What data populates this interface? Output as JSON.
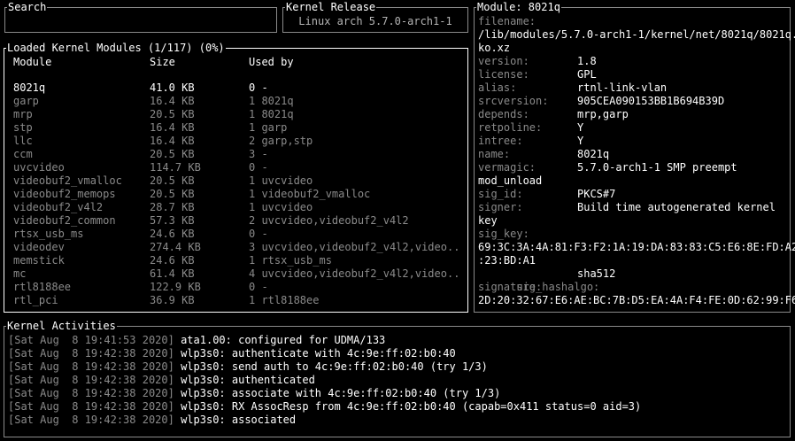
{
  "search": {
    "title": "Search",
    "value": ""
  },
  "kernel_release": {
    "title": "Kernel Release",
    "value": "Linux arch 5.7.0-arch1-1"
  },
  "modules": {
    "title": "Loaded Kernel Modules (1/117) (0%)",
    "columns": {
      "name": "Module",
      "size": "Size",
      "used_by": "Used by"
    },
    "rows": [
      {
        "name": "8021q",
        "size": "41.0 KB",
        "used_by": "0 -"
      },
      {
        "name": "garp",
        "size": "16.4 KB",
        "used_by": "1 8021q"
      },
      {
        "name": "mrp",
        "size": "20.5 KB",
        "used_by": "1 8021q"
      },
      {
        "name": "stp",
        "size": "16.4 KB",
        "used_by": "1 garp"
      },
      {
        "name": "llc",
        "size": "16.4 KB",
        "used_by": "2 garp,stp"
      },
      {
        "name": "ccm",
        "size": "20.5 KB",
        "used_by": "3 -"
      },
      {
        "name": "uvcvideo",
        "size": "114.7 KB",
        "used_by": "0 -"
      },
      {
        "name": "videobuf2_vmalloc",
        "size": "20.5 KB",
        "used_by": "1 uvcvideo"
      },
      {
        "name": "videobuf2_memops",
        "size": "20.5 KB",
        "used_by": "1 videobuf2_vmalloc"
      },
      {
        "name": "videobuf2_v4l2",
        "size": "28.7 KB",
        "used_by": "1 uvcvideo"
      },
      {
        "name": "videobuf2_common",
        "size": "57.3 KB",
        "used_by": "2 uvcvideo,videobuf2_v4l2"
      },
      {
        "name": "rtsx_usb_ms",
        "size": "24.6 KB",
        "used_by": "0 -"
      },
      {
        "name": "videodev",
        "size": "274.4 KB",
        "used_by": "3 uvcvideo,videobuf2_v4l2,video..."
      },
      {
        "name": "memstick",
        "size": "24.6 KB",
        "used_by": "1 rtsx_usb_ms"
      },
      {
        "name": "mc",
        "size": "61.4 KB",
        "used_by": "4 uvcvideo,videobuf2_v4l2,video..."
      },
      {
        "name": "rtl8188ee",
        "size": "122.9 KB",
        "used_by": "0 -"
      },
      {
        "name": "rtl_pci",
        "size": "36.9 KB",
        "used_by": "1 rtl8188ee"
      }
    ]
  },
  "module_info": {
    "title": "Module: 8021q",
    "filename_key": "filename:",
    "filename_lines": [
      "/lib/modules/5.7.0-arch1-1/kernel/net/8021q/8021q.",
      "ko.xz"
    ],
    "fields": [
      {
        "key": "version:",
        "value": "1.8"
      },
      {
        "key": "license:",
        "value": "GPL"
      },
      {
        "key": "alias:",
        "value": "rtnl-link-vlan"
      },
      {
        "key": "srcversion:",
        "value": "905CEA090153BB1B694B39D"
      },
      {
        "key": "depends:",
        "value": "mrp,garp"
      },
      {
        "key": "retpoline:",
        "value": "Y"
      },
      {
        "key": "intree:",
        "value": "Y"
      },
      {
        "key": "name:",
        "value": "8021q"
      },
      {
        "key": "vermagic:",
        "value": "5.7.0-arch1-1 SMP preempt"
      }
    ],
    "vermagic_cont": "mod_unload",
    "fields2": [
      {
        "key": "sig_id:",
        "value": "PKCS#7"
      },
      {
        "key": "signer:",
        "value": "Build time autogenerated kernel"
      }
    ],
    "signer_cont": "key",
    "sig_key_key": "sig_key:",
    "sig_key_lines": [
      "69:3C:3A:4A:81:F3:F2:1A:19:DA:83:83:C5:E6:8E:FD:A2",
      ":23:BD:A1"
    ],
    "sig_hashalgo": {
      "key": "sig_hashalgo:",
      "value": "sha512"
    },
    "signature_key": "signature:",
    "signature_lines": [
      "2D:20:32:67:E6:AE:BC:7B:D5:EA:4A:F4:FE:0D:62:99:F6"
    ]
  },
  "activities": {
    "title": "Kernel Activities",
    "entries": [
      {
        "ts": "[Sat Aug  8 19:41:53 2020]",
        "msg": "ata1.00: configured for UDMA/133"
      },
      {
        "ts": "[Sat Aug  8 19:42:38 2020]",
        "msg": "wlp3s0: authenticate with 4c:9e:ff:02:b0:40"
      },
      {
        "ts": "[Sat Aug  8 19:42:38 2020]",
        "msg": "wlp3s0: send auth to 4c:9e:ff:02:b0:40 (try 1/3)"
      },
      {
        "ts": "[Sat Aug  8 19:42:38 2020]",
        "msg": "wlp3s0: authenticated"
      },
      {
        "ts": "[Sat Aug  8 19:42:38 2020]",
        "msg": "wlp3s0: associate with 4c:9e:ff:02:b0:40 (try 1/3)"
      },
      {
        "ts": "[Sat Aug  8 19:42:38 2020]",
        "msg": "wlp3s0: RX AssocResp from 4c:9e:ff:02:b0:40 (capab=0x411 status=0 aid=3)"
      },
      {
        "ts": "[Sat Aug  8 19:42:38 2020]",
        "msg": "wlp3s0: associated"
      }
    ]
  },
  "colors": {
    "background": "#000000",
    "text": "#ffffff",
    "dim": "#8a8a8a",
    "border": "#8a8a8a",
    "active_border": "#ffffff"
  }
}
